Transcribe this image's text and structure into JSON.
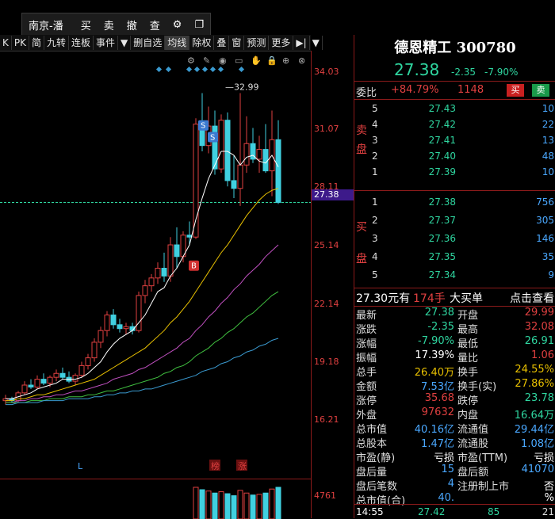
{
  "trade_toolbar": {
    "account": "南京-潘",
    "buy": "买",
    "sell": "卖",
    "cancel": "撤",
    "query": "查",
    "settings_icon": "gear-icon",
    "window_icon": "window-icon"
  },
  "toolbar": {
    "items": [
      "K",
      "PK",
      "简",
      "九转",
      "连板",
      "事件",
      "▼",
      "删自选",
      "均线",
      "除权",
      "叠",
      "窗",
      "预测",
      "更多",
      "▶|",
      "▼"
    ],
    "selected_index": 8
  },
  "chart_icons": [
    "gear-icon",
    "pen-icon",
    "eye-icon",
    "ruler-icon",
    "hand-icon",
    "lock-icon",
    "plus-icon",
    "close-icon"
  ],
  "axis": {
    "ticks": [
      "34.03",
      "31.07",
      "28.11",
      "25.14",
      "22.14",
      "19.18",
      "16.21",
      "4761"
    ],
    "current_price": "27.38"
  },
  "chart_data": {
    "type": "candlestick",
    "ylim": [
      16.21,
      34.03
    ],
    "high_label": "32.99",
    "markers": [
      "S",
      "S",
      "B"
    ],
    "bottom_labels": [
      "L",
      "榜",
      "涨"
    ],
    "candles": [
      [
        17.2,
        17.5,
        17.0,
        17.3
      ],
      [
        17.3,
        17.4,
        17.1,
        17.2
      ],
      [
        17.2,
        17.7,
        17.1,
        17.6
      ],
      [
        17.6,
        18.2,
        17.5,
        18.0
      ],
      [
        18.0,
        18.3,
        17.8,
        17.9
      ],
      [
        17.9,
        18.5,
        17.8,
        18.3
      ],
      [
        18.3,
        18.6,
        18.0,
        18.1
      ],
      [
        18.1,
        18.5,
        17.9,
        18.4
      ],
      [
        18.4,
        18.8,
        18.2,
        18.6
      ],
      [
        18.6,
        18.9,
        18.3,
        18.4
      ],
      [
        18.4,
        18.7,
        18.1,
        18.2
      ],
      [
        18.2,
        18.6,
        18.0,
        18.5
      ],
      [
        18.5,
        19.2,
        18.4,
        19.0
      ],
      [
        19.0,
        19.6,
        18.8,
        19.4
      ],
      [
        19.4,
        20.4,
        19.2,
        20.2
      ],
      [
        20.2,
        21.0,
        19.9,
        20.8
      ],
      [
        20.8,
        21.8,
        20.5,
        21.6
      ],
      [
        21.6,
        21.9,
        20.9,
        21.1
      ],
      [
        21.1,
        21.4,
        20.7,
        20.9
      ],
      [
        20.9,
        21.2,
        20.6,
        21.0
      ],
      [
        21.0,
        21.2,
        20.6,
        20.8
      ],
      [
        20.8,
        22.8,
        20.7,
        22.6
      ],
      [
        22.6,
        23.4,
        22.2,
        23.1
      ],
      [
        23.1,
        23.7,
        22.8,
        23.5
      ],
      [
        23.5,
        24.3,
        23.2,
        24.0
      ],
      [
        24.0,
        24.8,
        23.3,
        23.6
      ],
      [
        23.6,
        25.6,
        23.3,
        25.2
      ],
      [
        25.2,
        26.1,
        24.0,
        24.6
      ],
      [
        24.6,
        25.9,
        24.3,
        25.7
      ],
      [
        25.7,
        26.4,
        25.2,
        25.6
      ],
      [
        25.6,
        31.7,
        25.5,
        31.4
      ],
      [
        31.4,
        32.99,
        30.0,
        30.3
      ],
      [
        30.3,
        32.3,
        29.9,
        31.3
      ],
      [
        31.3,
        32.1,
        28.8,
        29.1
      ],
      [
        29.1,
        31.9,
        28.9,
        31.6
      ],
      [
        31.6,
        32.0,
        28.2,
        28.5
      ],
      [
        28.5,
        29.8,
        27.6,
        28.1
      ],
      [
        28.1,
        32.99,
        27.2,
        29.3
      ],
      [
        29.3,
        31.8,
        28.9,
        30.4
      ],
      [
        30.4,
        31.2,
        29.4,
        29.6
      ],
      [
        29.6,
        30.8,
        28.9,
        30.1
      ],
      [
        30.1,
        31.4,
        28.9,
        29.0
      ],
      [
        29.0,
        32.1,
        27.7,
        30.6
      ],
      [
        30.6,
        31.6,
        27.3,
        27.38
      ]
    ],
    "ma": [
      {
        "color": "#ffffff",
        "values": [
          17.3,
          17.3,
          17.4,
          17.5,
          17.6,
          17.8,
          17.9,
          18.0,
          18.1,
          18.3,
          18.3,
          18.3,
          18.4,
          18.6,
          18.9,
          19.2,
          19.7,
          20.1,
          20.4,
          20.6,
          20.8,
          21.2,
          21.6,
          22.2,
          22.8,
          23.0,
          23.6,
          24.0,
          24.6,
          25.2,
          26.5,
          27.6,
          28.6,
          29.3,
          30.0,
          30.0,
          29.8,
          29.3,
          29.7,
          29.8,
          29.5,
          29.4,
          29.8,
          29.2
        ]
      },
      {
        "color": "#e8c000",
        "values": [
          17.2,
          17.2,
          17.3,
          17.3,
          17.4,
          17.5,
          17.5,
          17.6,
          17.7,
          17.8,
          17.9,
          18.0,
          18.1,
          18.2,
          18.3,
          18.5,
          18.7,
          18.9,
          19.1,
          19.3,
          19.5,
          19.7,
          19.9,
          20.2,
          20.5,
          20.8,
          21.2,
          21.5,
          21.9,
          22.3,
          22.8,
          23.3,
          23.8,
          24.3,
          24.8,
          25.2,
          25.7,
          26.2,
          26.7,
          27.1,
          27.5,
          27.8,
          28.0,
          28.1
        ]
      },
      {
        "color": "#c050c0",
        "values": [
          17.1,
          17.1,
          17.2,
          17.2,
          17.3,
          17.3,
          17.4,
          17.4,
          17.5,
          17.5,
          17.6,
          17.7,
          17.7,
          17.8,
          17.9,
          18.0,
          18.1,
          18.3,
          18.4,
          18.5,
          18.6,
          18.8,
          18.9,
          19.1,
          19.3,
          19.5,
          19.7,
          19.9,
          20.2,
          20.4,
          20.8,
          21.1,
          21.5,
          21.8,
          22.2,
          22.5,
          22.9,
          23.2,
          23.6,
          23.9,
          24.2,
          24.6,
          24.9,
          25.2
        ]
      },
      {
        "color": "#40c040",
        "values": [
          17.1,
          17.1,
          17.1,
          17.1,
          17.2,
          17.2,
          17.2,
          17.3,
          17.3,
          17.3,
          17.4,
          17.4,
          17.4,
          17.5,
          17.5,
          17.6,
          17.7,
          17.7,
          17.8,
          17.9,
          18.0,
          18.1,
          18.2,
          18.3,
          18.4,
          18.6,
          18.7,
          18.9,
          19.0,
          19.2,
          19.5,
          19.7,
          19.9,
          20.2,
          20.4,
          20.7,
          20.9,
          21.2,
          21.5,
          21.7,
          22.0,
          22.3,
          22.6,
          22.8
        ]
      },
      {
        "color": "#3a9ad0",
        "values": [
          17.0,
          17.0,
          17.1,
          17.1,
          17.1,
          17.1,
          17.2,
          17.2,
          17.2,
          17.2,
          17.3,
          17.3,
          17.3,
          17.3,
          17.4,
          17.4,
          17.5,
          17.5,
          17.6,
          17.6,
          17.7,
          17.7,
          17.8,
          17.8,
          17.9,
          18.0,
          18.1,
          18.2,
          18.3,
          18.4,
          18.5,
          18.7,
          18.8,
          18.9,
          19.1,
          19.2,
          19.4,
          19.5,
          19.7,
          19.8,
          20.0,
          20.1,
          20.3,
          20.4
        ]
      }
    ],
    "volume": [
      1200,
      900,
      1500,
      1800,
      1100,
      1300,
      1000,
      1400,
      1600,
      1200,
      900,
      1300,
      1900,
      2100,
      2600,
      2900,
      3200,
      2200,
      1800,
      1700,
      1600,
      3400,
      3000,
      3200,
      3500,
      3100,
      3900,
      3300,
      3400,
      3000,
      4761,
      4400,
      4200,
      3900,
      4100,
      3800,
      3500,
      4300,
      3900,
      3600,
      3700,
      3900,
      4500,
      4761
    ],
    "ma_dots_count": 8
  },
  "stock": {
    "name": "德恩精工",
    "code": "300780",
    "price": "27.38",
    "change": "-2.35",
    "change_pct": "-7.90%"
  },
  "order_ratio": {
    "label": "委比",
    "ratio": "+84.79%",
    "diff": "1148",
    "buy_btn": "买",
    "sell_btn": "卖"
  },
  "ask_label": [
    "卖",
    "盘"
  ],
  "bid_label": [
    "买",
    "盘"
  ],
  "asks": [
    {
      "level": "5",
      "price": "27.43",
      "vol": "10"
    },
    {
      "level": "4",
      "price": "27.42",
      "vol": "22"
    },
    {
      "level": "3",
      "price": "27.41",
      "vol": "13"
    },
    {
      "level": "2",
      "price": "27.40",
      "vol": "48"
    },
    {
      "level": "1",
      "price": "27.39",
      "vol": "10"
    }
  ],
  "bids": [
    {
      "level": "1",
      "price": "27.38",
      "vol": "756"
    },
    {
      "level": "2",
      "price": "27.37",
      "vol": "305"
    },
    {
      "level": "3",
      "price": "27.36",
      "vol": "146"
    },
    {
      "level": "4",
      "price": "27.35",
      "vol": "35"
    },
    {
      "level": "5",
      "price": "27.34",
      "vol": "9"
    }
  ],
  "big_order": {
    "price_text": "27.30元有",
    "qty": "174手",
    "label": "大买单",
    "link": "点击查看"
  },
  "stats": [
    {
      "k": "最新",
      "v": "27.38",
      "vc": "#2fd6a0",
      "k2": "开盘",
      "v2": "29.99",
      "v2c": "#e04040"
    },
    {
      "k": "涨跌",
      "v": "-2.35",
      "vc": "#2fd6a0",
      "k2": "最高",
      "v2": "32.08",
      "v2c": "#e04040"
    },
    {
      "k": "涨幅",
      "v": "-7.90%",
      "vc": "#2fd6a0",
      "k2": "最低",
      "v2": "26.91",
      "v2c": "#2fd6a0"
    },
    {
      "k": "振幅",
      "v": "17.39%",
      "vc": "#ffffff",
      "k2": "量比",
      "v2": "1.06",
      "v2c": "#e04040"
    },
    {
      "k": "总手",
      "v": "26.40万",
      "vc": "#e8c000",
      "k2": "换手",
      "v2": "24.55%",
      "v2c": "#e8c000"
    },
    {
      "k": "金额",
      "v": "7.53亿",
      "vc": "#4aa8ff",
      "k2": "换手(实)",
      "v2": "27.86%",
      "v2c": "#e8c000"
    },
    {
      "k": "涨停",
      "v": "35.68",
      "vc": "#e04040",
      "k2": "跌停",
      "v2": "23.78",
      "v2c": "#2fd6a0"
    },
    {
      "k": "外盘",
      "v": "97632",
      "vc": "#e04040",
      "k2": "内盘",
      "v2": "16.64万",
      "v2c": "#2fd6a0"
    },
    {
      "k": "总市值",
      "v": "40.16亿",
      "vc": "#4aa8ff",
      "k2": "流通值",
      "v2": "29.44亿",
      "v2c": "#4aa8ff"
    },
    {
      "k": "总股本",
      "v": "1.47亿",
      "vc": "#4aa8ff",
      "k2": "流通股",
      "v2": "1.08亿",
      "v2c": "#4aa8ff"
    },
    {
      "k": "市盈(静)",
      "v": "亏损",
      "vc": "#ffffff",
      "k2": "市盈(TTM)",
      "v2": "亏损",
      "v2c": "#ffffff"
    },
    {
      "k": "盘后量",
      "v": "15",
      "vc": "#4aa8ff",
      "k2": "盘后额",
      "v2": "41070",
      "v2c": "#4aa8ff"
    },
    {
      "k": "盘后笔数",
      "v": "4",
      "vc": "#4aa8ff",
      "k2": "注册制上市",
      "v2": "否",
      "v2c": "#ffffff"
    },
    {
      "k": "总市值(合)",
      "v": "40.",
      "vc": "#4aa8ff",
      "k2": "",
      "v2": "%",
      "v2c": "#ffffff"
    }
  ],
  "footer": {
    "time": "14:55",
    "price": "27.42",
    "vol": "85",
    "flag": "21"
  },
  "colors": {
    "up": "#e04040",
    "down": "#2fd6a0",
    "axis": "#8b1a1a",
    "current": "#3d1a8a"
  }
}
